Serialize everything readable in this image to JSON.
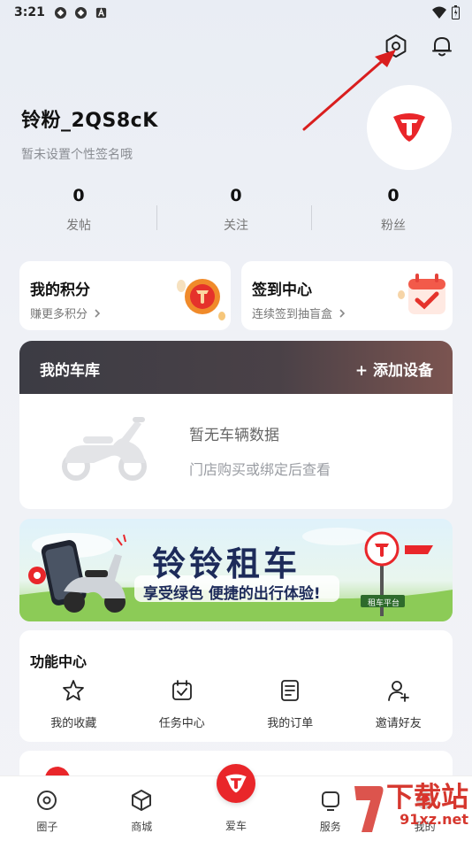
{
  "status_bar": {
    "time": "3:21"
  },
  "profile": {
    "nickname": "铃粉_2QS8cK",
    "signature": "暂未设置个性签名哦"
  },
  "stats": [
    {
      "value": "0",
      "label": "发帖"
    },
    {
      "value": "0",
      "label": "关注"
    },
    {
      "value": "0",
      "label": "粉丝"
    }
  ],
  "points_card": {
    "title": "我的积分",
    "subtitle": "赚更多积分"
  },
  "checkin_card": {
    "title": "签到中心",
    "subtitle": "连续签到抽盲盒"
  },
  "garage": {
    "title": "我的车库",
    "add_label": "+ 添加设备",
    "empty_title": "暂无车辆数据",
    "empty_hint": "门店购买或绑定后查看"
  },
  "banner": {
    "title": "铃铃租车",
    "slogan": "享受绿色 便捷的出行体验!",
    "sign": "租车平台"
  },
  "functions": {
    "title": "功能中心",
    "items": [
      {
        "icon": "star-icon",
        "label": "我的收藏"
      },
      {
        "icon": "calendar-check-icon",
        "label": "任务中心"
      },
      {
        "icon": "order-list-icon",
        "label": "我的订单"
      },
      {
        "icon": "user-add-icon",
        "label": "邀请好友"
      }
    ]
  },
  "tabbar": [
    {
      "icon": "circle-icon",
      "label": "圈子"
    },
    {
      "icon": "cube-icon",
      "label": "商城"
    },
    {
      "icon": "brand-logo-icon",
      "label": "爱车"
    },
    {
      "icon": "service-icon",
      "label": "服务"
    },
    {
      "icon": "me-icon",
      "label": "我的"
    }
  ],
  "watermark": {
    "big": "下载站",
    "small": "91xz.net"
  },
  "colors": {
    "brand_red": "#e9262a",
    "garage_header": "#4a4147"
  }
}
